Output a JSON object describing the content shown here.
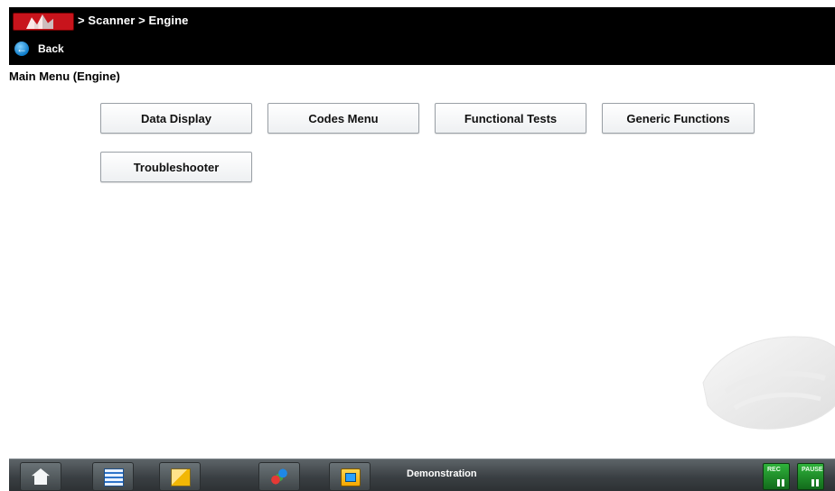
{
  "header": {
    "breadcrumb": "> Scanner  > Engine",
    "back_label": "Back"
  },
  "main": {
    "title": "Main Menu (Engine)",
    "buttons": [
      {
        "label": "Data Display"
      },
      {
        "label": "Codes Menu"
      },
      {
        "label": "Functional Tests"
      },
      {
        "label": "Generic Functions"
      },
      {
        "label": "Troubleshooter"
      }
    ]
  },
  "taskbar": {
    "status": "Demonstration",
    "icons": [
      "home-icon",
      "list-icon",
      "document-icon",
      "car-icon",
      "monitor-icon",
      "record-icon",
      "pause-icon"
    ],
    "record_label": "REC",
    "pause_label": "PAUSE"
  },
  "colors": {
    "topbar": "#000000",
    "app_icon_red": "#c8141c",
    "back_icon_blue": "#0b79c7",
    "taskbar": "#3a3f43",
    "record_green": "#2fb23b"
  }
}
